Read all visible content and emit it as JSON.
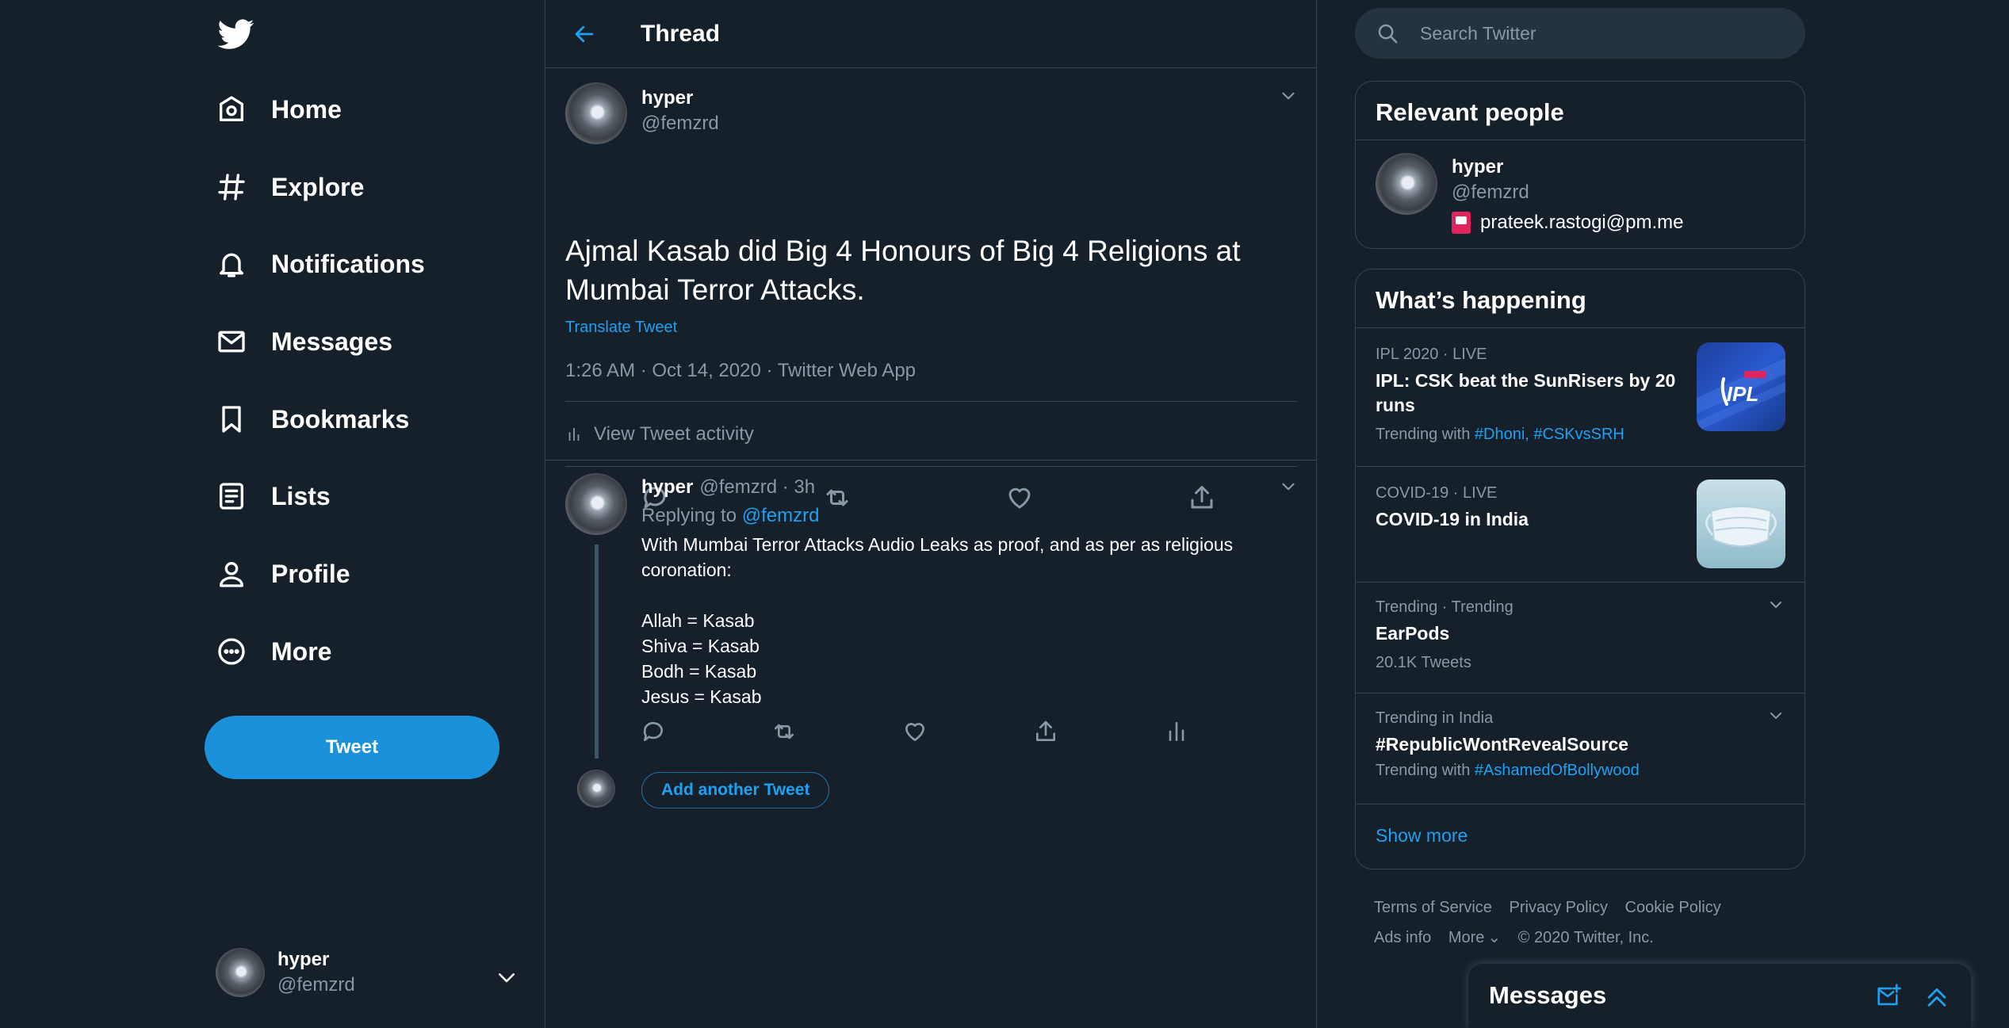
{
  "nav": {
    "items": [
      {
        "label": "Home",
        "icon": "home-icon"
      },
      {
        "label": "Explore",
        "icon": "hashtag-icon"
      },
      {
        "label": "Notifications",
        "icon": "bell-icon"
      },
      {
        "label": "Messages",
        "icon": "envelope-icon"
      },
      {
        "label": "Bookmarks",
        "icon": "bookmark-icon"
      },
      {
        "label": "Lists",
        "icon": "list-icon"
      },
      {
        "label": "Profile",
        "icon": "person-icon"
      },
      {
        "label": "More",
        "icon": "more-circle-icon"
      }
    ],
    "tweet_button": "Tweet"
  },
  "account": {
    "name": "hyper",
    "handle": "@femzrd"
  },
  "thread": {
    "title": "Thread",
    "main": {
      "name": "hyper",
      "handle": "@femzrd",
      "text": "Ajmal Kasab did Big 4 Honours of Big 4 Religions at Mumbai Terror Attacks.",
      "translate": "Translate Tweet",
      "meta": "1:26 AM · Oct 14, 2020 · Twitter Web App",
      "activity": "View Tweet activity"
    },
    "reply": {
      "name": "hyper",
      "handle_time": "@femzrd · 3h",
      "replying_prefix": "Replying to",
      "replying_to": "@femzrd",
      "lines": [
        "With Mumbai Terror Attacks Audio Leaks as proof, and as per as religious coronation:",
        "",
        "Allah = Kasab",
        "Shiva = Kasab",
        "Bodh = Kasab",
        "Jesus = Kasab"
      ]
    },
    "add_button": "Add another Tweet"
  },
  "search": {
    "placeholder": "Search Twitter"
  },
  "relevant": {
    "title": "Relevant people",
    "name": "hyper",
    "handle": "@femzrd",
    "bio": "prateek.rastogi@pm.me"
  },
  "happening": {
    "title": "What’s happening",
    "trends": [
      {
        "context": "IPL 2020 · LIVE",
        "title": "IPL: CSK beat the SunRisers by 20 runs",
        "sub_prefix": "Trending with",
        "sub_links": "#Dhoni, #CSKvsSRH"
      },
      {
        "context": "COVID-19 · LIVE",
        "title": "COVID-19 in India"
      },
      {
        "context": "Trending · Trending",
        "title": "EarPods",
        "sub": "20.1K Tweets"
      },
      {
        "context": "Trending in India",
        "title": "#RepublicWontRevealSource",
        "sub_prefix": "Trending with",
        "sub_links": "#AshamedOfBollywood"
      }
    ],
    "ipl_logo": "IPL",
    "show_more": "Show more"
  },
  "footer": {
    "terms": "Terms of Service",
    "privacy": "Privacy Policy",
    "cookie": "Cookie Policy",
    "ads": "Ads info",
    "more": "More",
    "copyright": "© 2020 Twitter, Inc."
  },
  "dock": {
    "title": "Messages"
  },
  "colors": {
    "background": "#15202b",
    "accent": "#1da1f2",
    "button": "#1a91da",
    "border": "#38444d",
    "muted": "#8899a6"
  }
}
